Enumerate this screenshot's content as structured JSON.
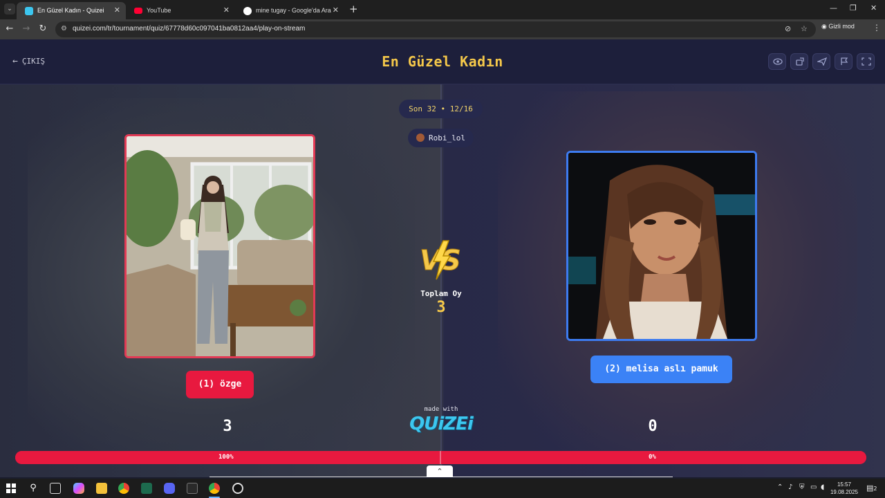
{
  "browser": {
    "tabs": [
      {
        "title": "En Güzel Kadın - Quizei",
        "active": true
      },
      {
        "title": "YouTube",
        "active": false
      },
      {
        "title": "mine tugay - Google'da Ara",
        "active": false
      }
    ],
    "url": "quizei.com/tr/tournament/quiz/67778d60c097041ba0812aa4/play-on-stream",
    "profile_label": "Gizli mod"
  },
  "header": {
    "exit_label": "ÇIKIŞ",
    "title": "En Güzel Kadın",
    "action_icons": [
      "eye-icon",
      "share-icon",
      "send-icon",
      "flag-icon",
      "fullscreen-icon"
    ]
  },
  "match": {
    "round_info": "Son 32 • 12/16",
    "username": "Robi_lol",
    "total_votes_label": "Toplam Oy",
    "total_votes": "3",
    "left": {
      "name": "(1) özge",
      "score": "3",
      "percent_label": "100%",
      "share": 1.0,
      "color": "#e8193f"
    },
    "right": {
      "name": "(2) melisa aslı pamuk",
      "score": "0",
      "percent_label": "0%",
      "share": 0.0,
      "color": "#3b82f6"
    }
  },
  "branding": {
    "made_with": "made with",
    "logo": "QUIZEI"
  },
  "taskbar": {
    "time": "15:57",
    "date": "19.08.2025",
    "notification_count": "2"
  }
}
